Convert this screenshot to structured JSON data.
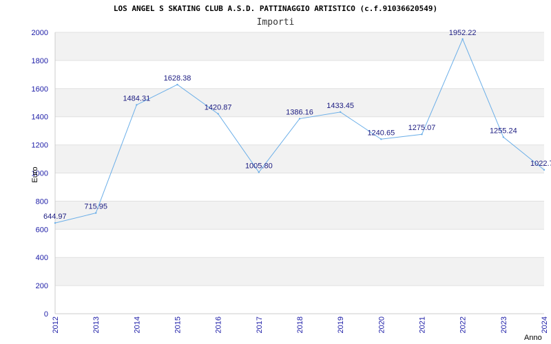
{
  "header": {
    "title": "LOS ANGEL S SKATING CLUB A.S.D. PATTINAGGIO ARTISTICO (c.f.91036620549)",
    "subtitle": "Importi"
  },
  "colors": {
    "line": "#6aaee8",
    "band": "#f2f2f2",
    "tick_text": "#1a1aa6",
    "data_label": "#1a1a80"
  },
  "chart_data": {
    "type": "line",
    "title": "LOS ANGEL S SKATING CLUB A.S.D. PATTINAGGIO ARTISTICO (c.f.91036620549)",
    "subtitle": "Importi",
    "xlabel": "Anno",
    "ylabel": "Euro",
    "ylim": [
      0,
      2000
    ],
    "yticks": [
      0,
      200,
      400,
      600,
      800,
      1000,
      1200,
      1400,
      1600,
      1800,
      2000
    ],
    "grid": true,
    "x": [
      "2012",
      "2013",
      "2014",
      "2015",
      "2016",
      "2017",
      "2018",
      "2019",
      "2020",
      "2021",
      "2022",
      "2023",
      "2024"
    ],
    "series": [
      {
        "values": [
          644.97,
          715.95,
          1484.31,
          1628.38,
          1420.87,
          1005.8,
          1386.16,
          1433.45,
          1240.65,
          1275.07,
          1952.22,
          1255.24,
          1022.7
        ],
        "labels": [
          "644.97",
          "715.95",
          "1484.31",
          "1628.38",
          "1420.87",
          "1005.80",
          "1386.16",
          "1433.45",
          "1240.65",
          "1275.07",
          "1952.22",
          "1255.24",
          "1022.7"
        ]
      }
    ]
  }
}
